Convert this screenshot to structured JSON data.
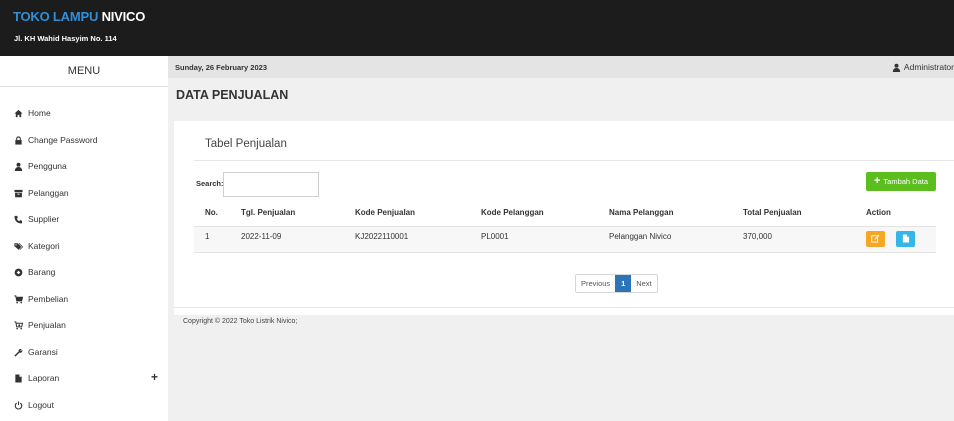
{
  "header": {
    "brand_part1": "TOKO LAMPU",
    "brand_part2": " NIVICO",
    "address": "Jl. KH Wahid Hasyim No. 114"
  },
  "sidebar": {
    "title": "MENU",
    "items": [
      {
        "label": "Home",
        "icon": "home-icon"
      },
      {
        "label": "Change Password",
        "icon": "lock-icon"
      },
      {
        "label": "Pengguna",
        "icon": "user-icon"
      },
      {
        "label": "Pelanggan",
        "icon": "archive-icon"
      },
      {
        "label": "Supplier",
        "icon": "phone-icon"
      },
      {
        "label": "Kategori",
        "icon": "tags-icon"
      },
      {
        "label": "Barang",
        "icon": "cube-icon"
      },
      {
        "label": "Pembelian",
        "icon": "cart-icon"
      },
      {
        "label": "Penjualan",
        "icon": "cart-arrow-icon"
      },
      {
        "label": "Garansi",
        "icon": "wrench-icon"
      },
      {
        "label": "Laporan",
        "icon": "file-icon",
        "expand": "+"
      },
      {
        "label": "Logout",
        "icon": "power-icon"
      }
    ]
  },
  "topbar": {
    "date": "Sunday, 26 February 2023",
    "user": "Administrator"
  },
  "main": {
    "page_title": "DATA PENJUALAN",
    "panel_title": "Tabel Penjualan",
    "search_label": "Search:",
    "search_value": "",
    "add_button": "Tambah Data",
    "columns": [
      "No.",
      "Tgl. Penjualan",
      "Kode Penjualan",
      "Kode Pelanggan",
      "Nama Pelanggan",
      "Total Penjualan",
      "Action"
    ],
    "rows": [
      {
        "no": "1",
        "tgl": "2022-11-09",
        "kode": "KJ2022110001",
        "kode_pelanggan": "PL0001",
        "nama": "Pelanggan Nivico",
        "total": "370,000"
      }
    ],
    "pagination": {
      "previous": "Previous",
      "current": "1",
      "next": "Next"
    },
    "copyright": "Copyright © 2022 Toko Listrik Nivico;"
  },
  "colors": {
    "brand_blue": "#2f8fd8",
    "topbar_bg": "#1c1c1c",
    "add_green": "#5cbd1f",
    "edit_orange": "#f5a623",
    "detail_blue": "#35b6e8",
    "pagination_active": "#2d73b7"
  }
}
